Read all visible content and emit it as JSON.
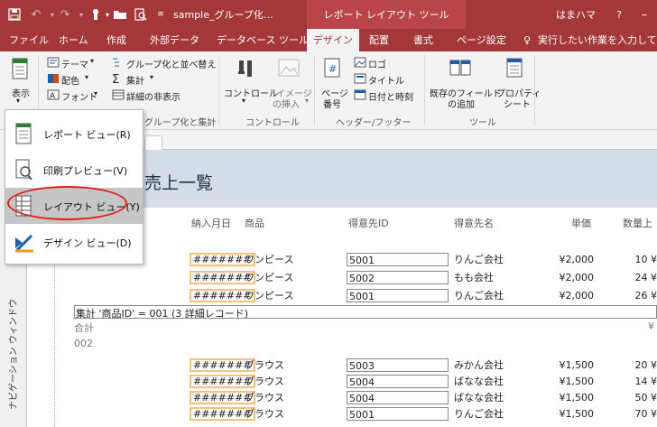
{
  "titlebar": {
    "filename": "sample_グループ化…",
    "context_tool": "レポート レイアウト ツール",
    "user": "はまハマ",
    "help": "?"
  },
  "tabs": [
    "ファイル",
    "ホーム",
    "作成",
    "外部データ",
    "データベース ツール",
    "デザイン",
    "配置",
    "書式",
    "ページ設定"
  ],
  "active_tab": "デザイン",
  "tell_me": "実行したい作業を入力してくださ",
  "ribbon": {
    "view_label": "表示",
    "theme_label": "テーマ",
    "color_label": "配色",
    "font_label": "フォント",
    "group_sort_label": "グループ化と並べ替え",
    "totals_label": "集計",
    "hide_details_label": "詳細の非表示",
    "group_sort_group": "グループ化と集計",
    "controls_label": "コントロール",
    "insert_image_label1": "イメージ",
    "insert_image_label2": "の挿入",
    "controls_group": "コントロール",
    "page_number_label1": "ページ",
    "page_number_label2": "番号",
    "logo_label": "ロゴ",
    "title_label": "タイトル",
    "date_time_label": "日付と時刻",
    "header_footer_group": "ヘッダー/フッター",
    "add_existing_label1": "既存のフィールド",
    "add_existing_label2": "の追加",
    "property_sheet_label1": "プロパティ",
    "property_sheet_label2": "シート",
    "tools_group": "ツール"
  },
  "view_menu": {
    "items": [
      {
        "label": "レポート ビュー(R)"
      },
      {
        "label": "印刷プレビュー(V)"
      },
      {
        "label": "レイアウト ビュー(Y)"
      },
      {
        "label": "デザイン ビュー(D)"
      }
    ],
    "highlighted": "レイアウト ビュー(Y)"
  },
  "nav_pane_label": "ナビゲーション ウィンドウ",
  "report": {
    "title": "売上一覧",
    "columns": [
      "納入月日",
      "商品",
      "得意先ID",
      "得意先名",
      "単価",
      "数量上"
    ],
    "group1": {
      "rows": [
        {
          "date": "#######",
          "product": "ワンピース",
          "customer_id": "5001",
          "customer_name": "りんご会社",
          "price": "¥2,000",
          "qty": "10 ¥"
        },
        {
          "date": "#######",
          "product": "ワンピース",
          "customer_id": "5002",
          "customer_name": "もも会社",
          "price": "¥2,000",
          "qty": "24 ¥"
        },
        {
          "date": "#######",
          "product": "ワンピース",
          "customer_id": "5001",
          "customer_name": "りんご会社",
          "price": "¥2,000",
          "qty": "26 ¥"
        }
      ],
      "summary": "集計 '商品ID' = 001 (3 詳細レコード)",
      "total_label": "合計",
      "total_value": "¥"
    },
    "group2_id": "002",
    "group2": {
      "rows": [
        {
          "date": "#######",
          "product": "ブラウス",
          "customer_id": "5003",
          "customer_name": "みかん会社",
          "price": "¥1,500",
          "qty": "20 ¥"
        },
        {
          "date": "#######",
          "product": "ブラウス",
          "customer_id": "5004",
          "customer_name": "ばなな会社",
          "price": "¥1,500",
          "qty": "14 ¥"
        },
        {
          "date": "#######",
          "product": "ブラウス",
          "customer_id": "5004",
          "customer_name": "ばなな会社",
          "price": "¥1,500",
          "qty": "50 ¥"
        },
        {
          "date": "#######",
          "product": "ブラウス",
          "customer_id": "5001",
          "customer_name": "りんご会社",
          "price": "¥1,500",
          "qty": "70 ¥"
        }
      ]
    }
  },
  "colors": {
    "accent": "#a4373a",
    "header_band": "#d5dde8",
    "highlight_circle": "#e02020",
    "date_box": "#f6c27a"
  }
}
